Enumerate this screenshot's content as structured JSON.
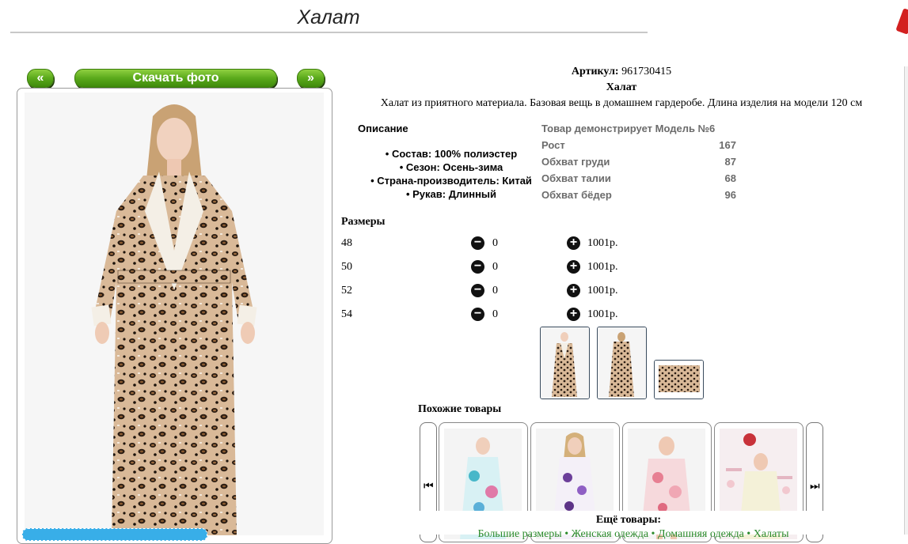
{
  "page": {
    "title": "Халат"
  },
  "nav": {
    "prev_label": "«",
    "download_label": "Скачать фото",
    "next_label": "»"
  },
  "product": {
    "article_label": "Артикул:",
    "article_value": "961730415",
    "name": "Халат",
    "description": "Халат из приятного материала. Базовая вещь в домашнем гардеробе. Длина изделия на модели 120 см"
  },
  "description_block": {
    "heading": "Описание",
    "features": [
      "Состав: 100% полиэстер",
      "Сезон: Осень-зима",
      "Страна-производитель: Китай",
      "Рукав: Длинный"
    ]
  },
  "model": {
    "heading": "Товар демонстрирует Модель №6",
    "rows": [
      {
        "label": "Рост",
        "value": "167"
      },
      {
        "label": "Обхват груди",
        "value": "87"
      },
      {
        "label": "Обхват талии",
        "value": "68"
      },
      {
        "label": "Обхват бёдер",
        "value": "96"
      }
    ]
  },
  "sizes": {
    "heading": "Размеры",
    "rows": [
      {
        "size": "48",
        "qty": "0",
        "price": "1001р."
      },
      {
        "size": "50",
        "qty": "0",
        "price": "1001р."
      },
      {
        "size": "52",
        "qty": "0",
        "price": "1001р."
      },
      {
        "size": "54",
        "qty": "0",
        "price": "1001р."
      }
    ],
    "minus_glyph": "−",
    "plus_glyph": "+"
  },
  "similar": {
    "heading": "Похожие товары",
    "prev_glyph": "⏮",
    "next_glyph": "⏭"
  },
  "more": {
    "heading": "Ещё товары:",
    "links": "Большие размеры • Женская одежда • Домашняя одежда • Халаты"
  },
  "colors": {
    "button_green": "#5aa91b",
    "link_green": "#2a8a2a",
    "accent_blue": "#38aee8"
  }
}
